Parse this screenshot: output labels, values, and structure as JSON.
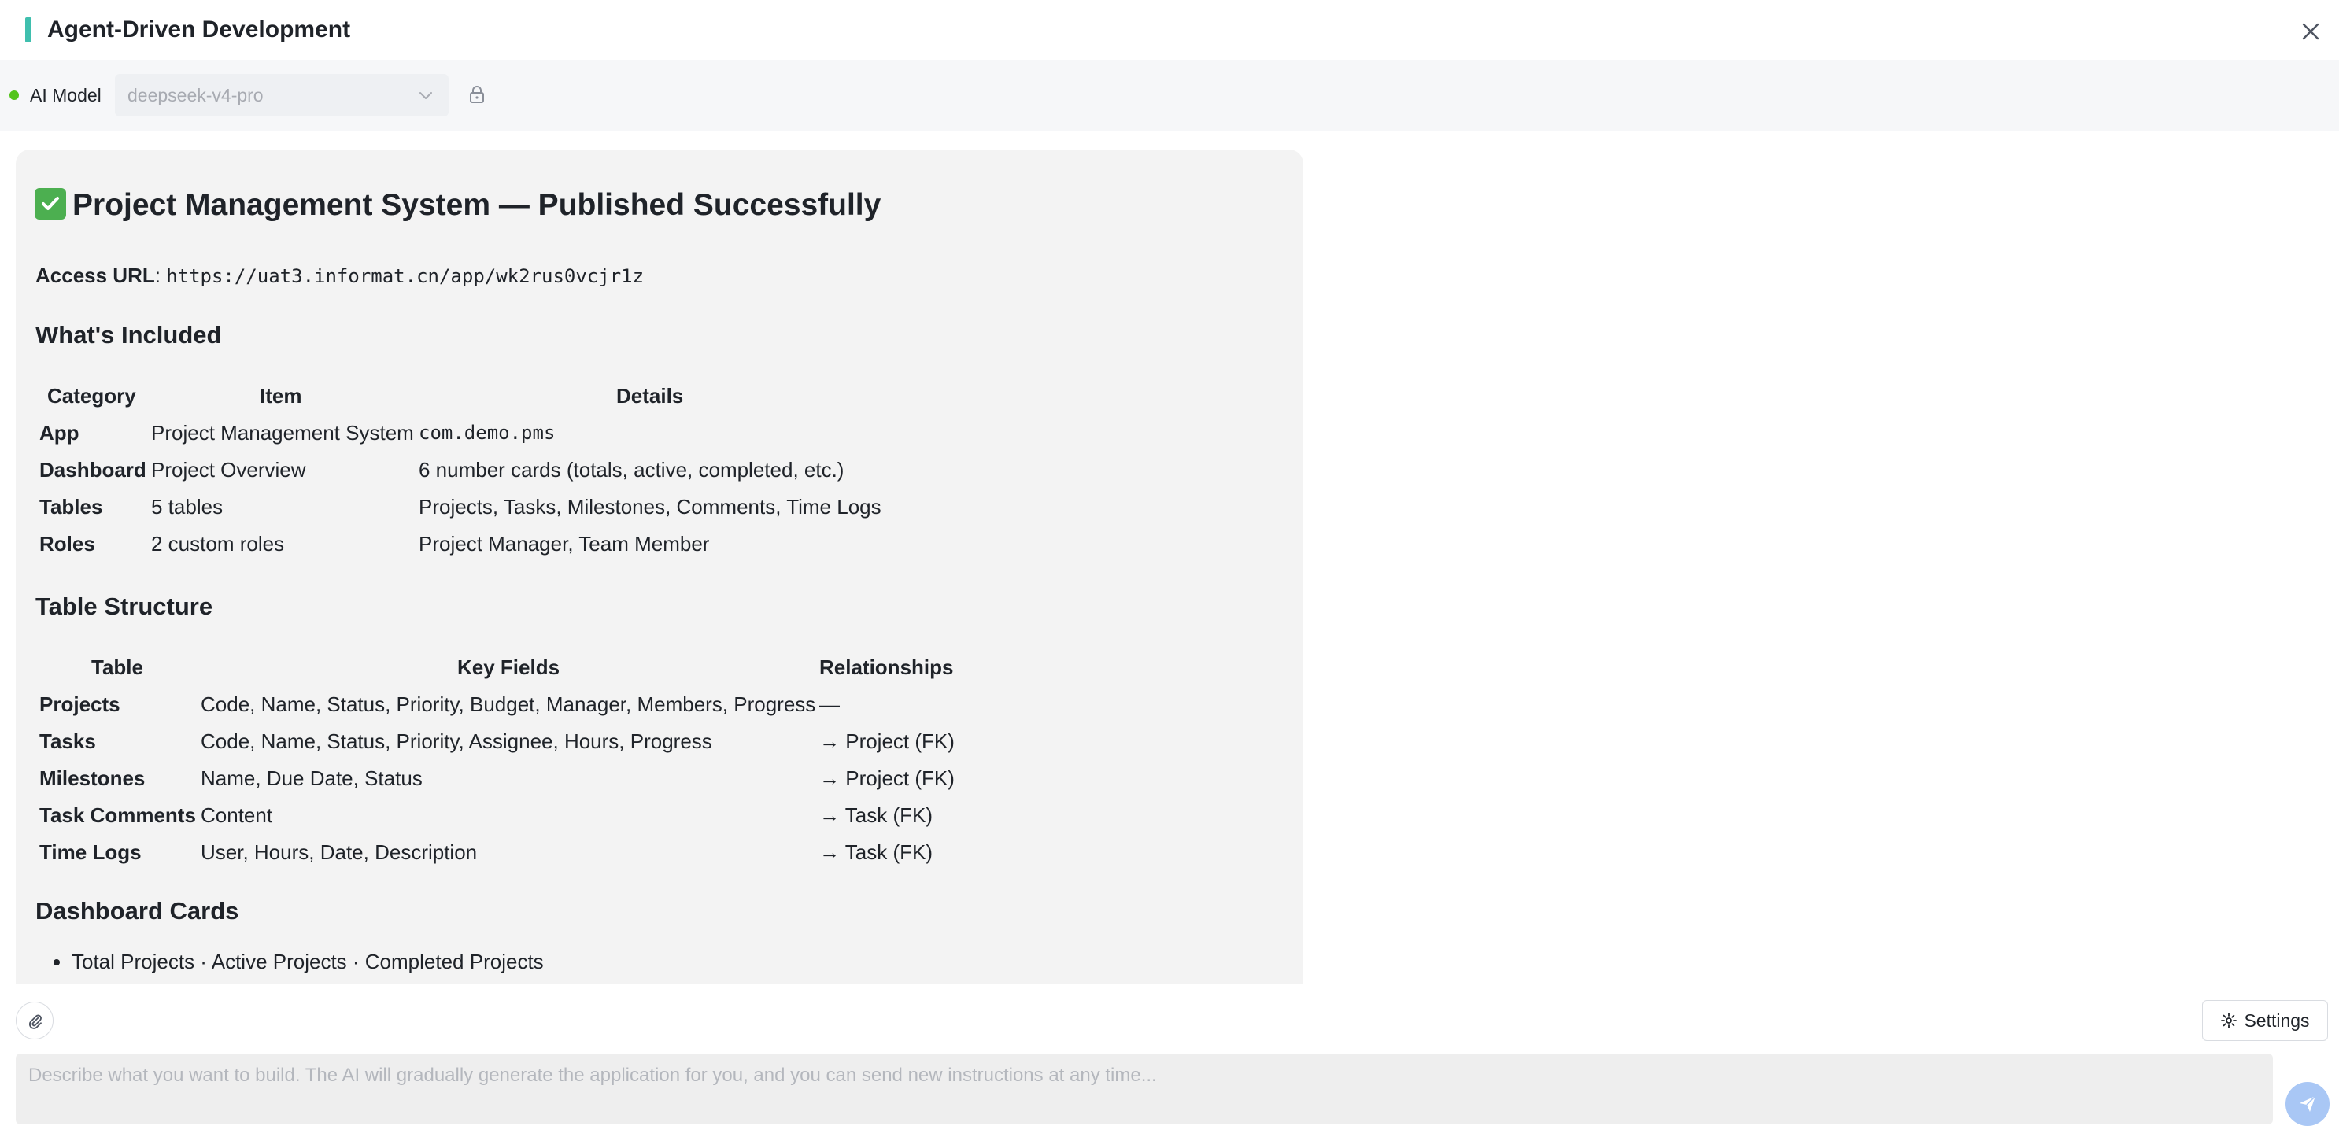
{
  "header": {
    "title": "Agent-Driven Development"
  },
  "toolbar": {
    "model_label": "AI Model",
    "model_value": "deepseek-v4-pro"
  },
  "message": {
    "title": "Project Management System — Published Successfully",
    "access_url_label": "Access URL",
    "access_url_value": "https://uat3.informat.cn/app/wk2rus0vcjr1z",
    "included_heading": "What's Included",
    "included_headers": [
      "Category",
      "Item",
      "Details"
    ],
    "included_rows": [
      [
        "App",
        "Project Management System",
        "com.demo.pms"
      ],
      [
        "Dashboard",
        "Project Overview",
        "6 number cards (totals, active, completed, etc.)"
      ],
      [
        "Tables",
        "5 tables",
        "Projects, Tasks, Milestones, Comments, Time Logs"
      ],
      [
        "Roles",
        "2 custom roles",
        "Project Manager, Team Member"
      ]
    ],
    "structure_heading": "Table Structure",
    "structure_headers": [
      "Table",
      "Key Fields",
      "Relationships"
    ],
    "structure_rows": [
      [
        "Projects",
        "Code, Name, Status, Priority, Budget, Manager, Members, Progress",
        "—"
      ],
      [
        "Tasks",
        "Code, Name, Status, Priority, Assignee, Hours, Progress",
        "→ Project (FK)"
      ],
      [
        "Milestones",
        "Name, Due Date, Status",
        "→ Project (FK)"
      ],
      [
        "Task Comments",
        "Content",
        "→ Task (FK)"
      ],
      [
        "Time Logs",
        "User, Hours, Date, Description",
        "→ Task (FK)"
      ]
    ],
    "cards_heading": "Dashboard Cards",
    "cards_items": [
      "Total Projects · Active Projects · Completed Projects"
    ]
  },
  "composer": {
    "settings_label": "Settings",
    "placeholder": "Describe what you want to build. The AI will gradually generate the application for you, and you can send new instructions at any time..."
  },
  "colors": {
    "accent": "#3fbfae",
    "status_dot": "#52c41a",
    "send_button": "#a9c7f5"
  }
}
